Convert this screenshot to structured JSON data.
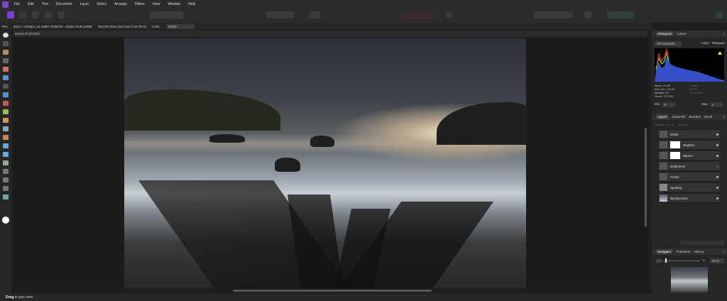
{
  "menu": [
    "File",
    "Edit",
    "Text",
    "Document",
    "Layer",
    "Select",
    "Arrange",
    "Filters",
    "View",
    "Window",
    "Help"
  ],
  "context": {
    "tool": "Pan",
    "info": "6016 × 4016px, 24.16MP, RGBA/8 - Adobe RGB (1998)",
    "camera": "NIKON D610 (16.0-35.0 mm f/4.0)",
    "units_label": "Units:",
    "units_value": "Pixels"
  },
  "document": {
    "tab": "Devon.tif (23.5%)"
  },
  "status": {
    "bold": "Drag",
    "rest": " to pan view."
  },
  "histogram": {
    "tabs": [
      "Histogram",
      "Colour"
    ],
    "channel": "All Channels",
    "layer": "Layer",
    "marquee": "Marquee",
    "mean": "Mean: 91.60",
    "stddev": "Std. Dev.: 50.59",
    "median": "Median: 82",
    "pixels": "Pixels: 377504",
    "levels": "Levels: -",
    "pixels2": "Pixels: -",
    "percentile": "Percentile: -",
    "min_label": "Min:",
    "min": "0",
    "max_label": "Max:",
    "max": "1"
  },
  "layers": {
    "tabs": [
      "Layers",
      "Channels",
      "Brushes",
      "Stock"
    ],
    "opacity": "Opacity: 100 %",
    "blend": "Normal",
    "items": [
      {
        "name": "Detail"
      },
      {
        "name": "Brighten"
      },
      {
        "name": "Bleach"
      },
      {
        "name": "Brightness"
      },
      {
        "name": "Points"
      },
      {
        "name": "Spotting"
      },
      {
        "name": "Background"
      }
    ]
  },
  "navigator": {
    "tabs": [
      "Navigator",
      "Transform",
      "History"
    ],
    "zoom": "24 %"
  },
  "colors": {
    "accent": "#7b3fd4",
    "bg": "#1e1e1e",
    "panel": "#262626"
  }
}
